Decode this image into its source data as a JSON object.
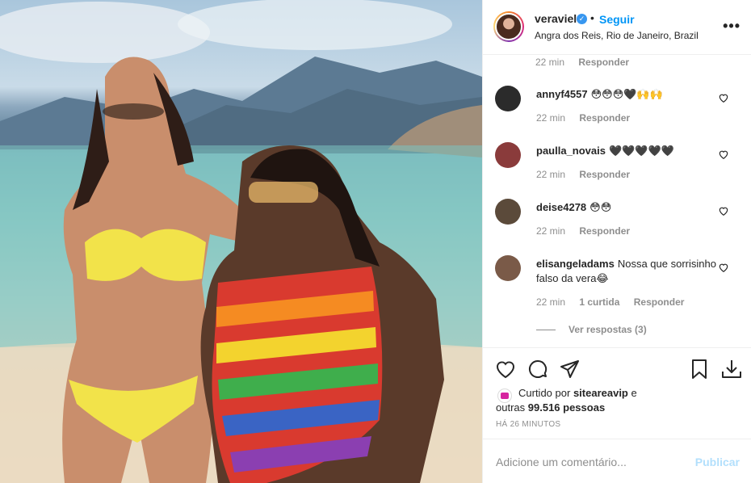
{
  "header": {
    "username": "veraviel",
    "verified_glyph": "✓",
    "separator": "•",
    "follow_label": "Seguir",
    "location": "Angra dos Reis, Rio de Janeiro, Brazil",
    "more_glyph": "•••"
  },
  "first_meta": {
    "time": "22 min",
    "reply": "Responder"
  },
  "comments": [
    {
      "user": "annyf4557",
      "text": "😳😳😳🖤🙌🙌",
      "time": "22 min",
      "reply": "Responder",
      "avatar_color": "#2b2b2b",
      "icon": "heart-outline-icon"
    },
    {
      "user": "paulla_novais",
      "text": "🖤🖤🖤🖤🖤",
      "time": "22 min",
      "reply": "Responder",
      "avatar_color": "#8a3b3b",
      "icon": "heart-outline-icon"
    },
    {
      "user": "deise4278",
      "text": "😳😳",
      "time": "22 min",
      "reply": "Responder",
      "avatar_color": "#5b4a3a",
      "icon": "heart-outline-icon"
    },
    {
      "user": "elisangeladams",
      "text": "Nossa que sorrisinho falso da vera😂",
      "time": "22 min",
      "likes": "1 curtida",
      "reply": "Responder",
      "avatar_color": "#7a5a48",
      "icon": "heart-outline-icon"
    }
  ],
  "view_replies": "Ver respostas (3)",
  "actions": {
    "like_icon": "heart-outline-icon",
    "comment_icon": "comment-icon",
    "share_icon": "send-icon",
    "save_icon": "bookmark-icon",
    "download_icon": "download-icon"
  },
  "liked_by": {
    "prefix": "Curtido por",
    "user": "siteareavip",
    "and": "e",
    "others_prefix": "outras",
    "others_count": "99.516 pessoas"
  },
  "time_ago": "HÁ 26 MINUTOS",
  "add_comment": {
    "placeholder": "Adicione um comentário...",
    "publish_label": "Publicar"
  },
  "colors": {
    "link": "#0095f6",
    "muted": "#8e8e8e",
    "publish_disabled": "#b2dffc",
    "verified": "#3897f0"
  }
}
